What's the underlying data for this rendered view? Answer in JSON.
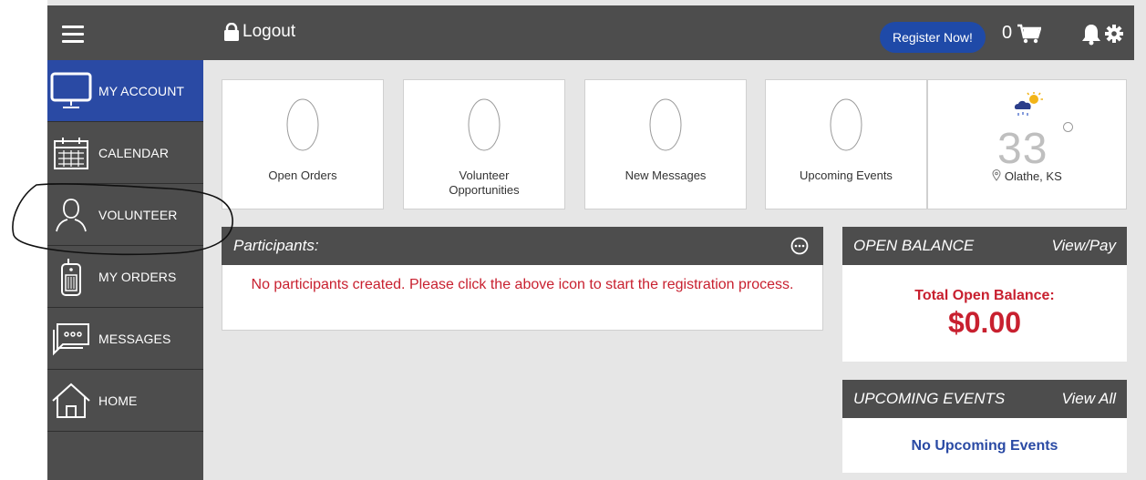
{
  "header": {
    "logout_label": "Logout",
    "register_label": "Register Now!",
    "cart_count": "0"
  },
  "sidebar": {
    "items": [
      {
        "label": "MY ACCOUNT",
        "icon": "monitor-icon",
        "active": true
      },
      {
        "label": "CALENDAR",
        "icon": "calendar-icon",
        "active": false
      },
      {
        "label": "VOLUNTEER",
        "icon": "person-icon",
        "active": false
      },
      {
        "label": "MY ORDERS",
        "icon": "phone-icon",
        "active": false
      },
      {
        "label": "MESSAGES",
        "icon": "chat-icon",
        "active": false
      },
      {
        "label": "HOME",
        "icon": "home-icon",
        "active": false
      }
    ]
  },
  "stats": [
    {
      "value": "0",
      "label": "Open Orders"
    },
    {
      "value": "0",
      "label": "Volunteer\nOpportunities"
    },
    {
      "value": "0",
      "label": "New Messages"
    },
    {
      "value": "0",
      "label": "Upcoming Events"
    }
  ],
  "weather": {
    "temp": "33",
    "location": "Olathe, KS",
    "icon": "partly-cloudy-snow-icon"
  },
  "participants": {
    "title": "Participants:",
    "message": "No participants created. Please click the above icon to start the registration process."
  },
  "balance": {
    "title": "OPEN BALANCE",
    "action": "View/Pay",
    "label": "Total Open Balance:",
    "amount": "$0.00"
  },
  "events": {
    "title": "UPCOMING EVENTS",
    "action": "View All",
    "empty": "No Upcoming Events"
  },
  "colors": {
    "dark_bar": "#4d4d4d",
    "accent_blue": "#2a4aa4",
    "alert_red": "#c8202f"
  }
}
